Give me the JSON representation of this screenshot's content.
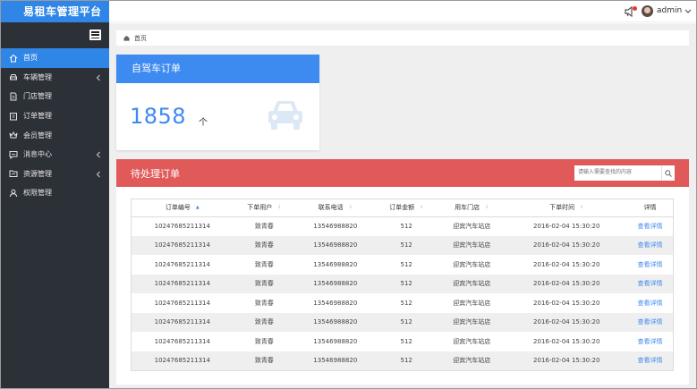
{
  "brand": {
    "title": "易租车管理平台"
  },
  "topbar": {
    "user_name": "admin"
  },
  "sidebar": {
    "items": [
      {
        "label": "首页",
        "icon": "home-icon",
        "active": true,
        "has_children": false
      },
      {
        "label": "车辆管理",
        "icon": "car-icon",
        "active": false,
        "has_children": true
      },
      {
        "label": "门店管理",
        "icon": "document-icon",
        "active": false,
        "has_children": false
      },
      {
        "label": "订单管理",
        "icon": "clipboard-icon",
        "active": false,
        "has_children": false
      },
      {
        "label": "会员管理",
        "icon": "crown-icon",
        "active": false,
        "has_children": false
      },
      {
        "label": "消息中心",
        "icon": "message-icon",
        "active": false,
        "has_children": true
      },
      {
        "label": "资源管理",
        "icon": "folder-icon",
        "active": false,
        "has_children": true
      },
      {
        "label": "权限管理",
        "icon": "user-icon",
        "active": false,
        "has_children": false
      }
    ]
  },
  "breadcrumb": {
    "label": "首页"
  },
  "card": {
    "title": "自驾车订单",
    "value": "1858",
    "unit": "个"
  },
  "panel": {
    "title": "待处理订单",
    "search_placeholder": "请输入需要查找的内容"
  },
  "table": {
    "columns": [
      "订单编号",
      "下单用户",
      "联系电话",
      "订单金额",
      "用车门店",
      "下单时间",
      "详情"
    ],
    "rows": [
      [
        "10247685211314",
        "致青春",
        "13546988820",
        "512",
        "迎宾汽车站店",
        "2016-02-04 15:30:20",
        "查看详情"
      ],
      [
        "10247685211314",
        "致青春",
        "13546988820",
        "512",
        "迎宾汽车站店",
        "2016-02-04 15:30:20",
        "查看详情"
      ],
      [
        "10247685211314",
        "致青春",
        "13546988820",
        "512",
        "迎宾汽车站店",
        "2016-02-04 15:30:20",
        "查看详情"
      ],
      [
        "10247685211314",
        "致青春",
        "13546988820",
        "512",
        "迎宾汽车站店",
        "2016-02-04 15:30:20",
        "查看详情"
      ],
      [
        "10247685211314",
        "致青春",
        "13546988820",
        "512",
        "迎宾汽车站店",
        "2016-02-04 15:30:20",
        "查看详情"
      ],
      [
        "10247685211314",
        "致青春",
        "13546988820",
        "512",
        "迎宾汽车站店",
        "2016-02-04 15:30:20",
        "查看详情"
      ],
      [
        "10247685211314",
        "致青春",
        "13546988820",
        "512",
        "迎宾汽车站店",
        "2016-02-04 15:30:20",
        "查看详情"
      ],
      [
        "10247685211314",
        "致青春",
        "13546988820",
        "512",
        "迎宾汽车站店",
        "2016-02-04 15:30:20",
        "查看详情"
      ]
    ]
  },
  "colors": {
    "accent": "#3d8af0",
    "sidebar_bg": "#2c3037",
    "panel_header": "#e05a5a"
  }
}
